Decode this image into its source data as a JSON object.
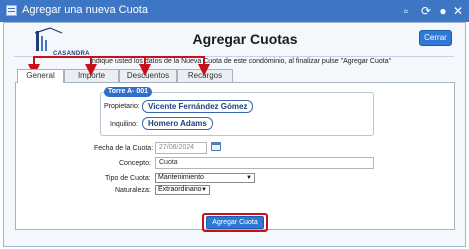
{
  "window": {
    "title": "Agregar una nueva Cuota"
  },
  "header": {
    "logo_text": "CASANDRA",
    "title": "Agregar Cuotas",
    "close_label": "Cerrar"
  },
  "instructions": "Indique usted los datos de la Nueva Cuota de este condóminio, al finalizar pulse \"Agregar Cuota\"",
  "tabs": [
    {
      "label": "General"
    },
    {
      "label": "Importe"
    },
    {
      "label": "Descuentos"
    },
    {
      "label": "Recargos"
    }
  ],
  "unit": {
    "tag": "Torre A- 001",
    "owner_label": "Propietario:",
    "owner_value": "Vicente Fernández Gómez",
    "tenant_label": "Inquilino:",
    "tenant_value": "Homero Adams"
  },
  "form": {
    "date_label": "Fecha de la Cuota:",
    "date_value": "27/08/2024",
    "concept_label": "Concepto:",
    "concept_value": "Cuota",
    "type_label": "Tipo de Cuota:",
    "type_value": "Mantenimiento",
    "nature_label": "Naturaleza:",
    "nature_value": "Extraordinario"
  },
  "actions": {
    "submit_label": "Agregar Cuota"
  },
  "colors": {
    "titlebar": "#3d76c4",
    "accent": "#2f79d6",
    "annotation_red": "#c8101a",
    "logo_blue": "#1f3f7a"
  }
}
